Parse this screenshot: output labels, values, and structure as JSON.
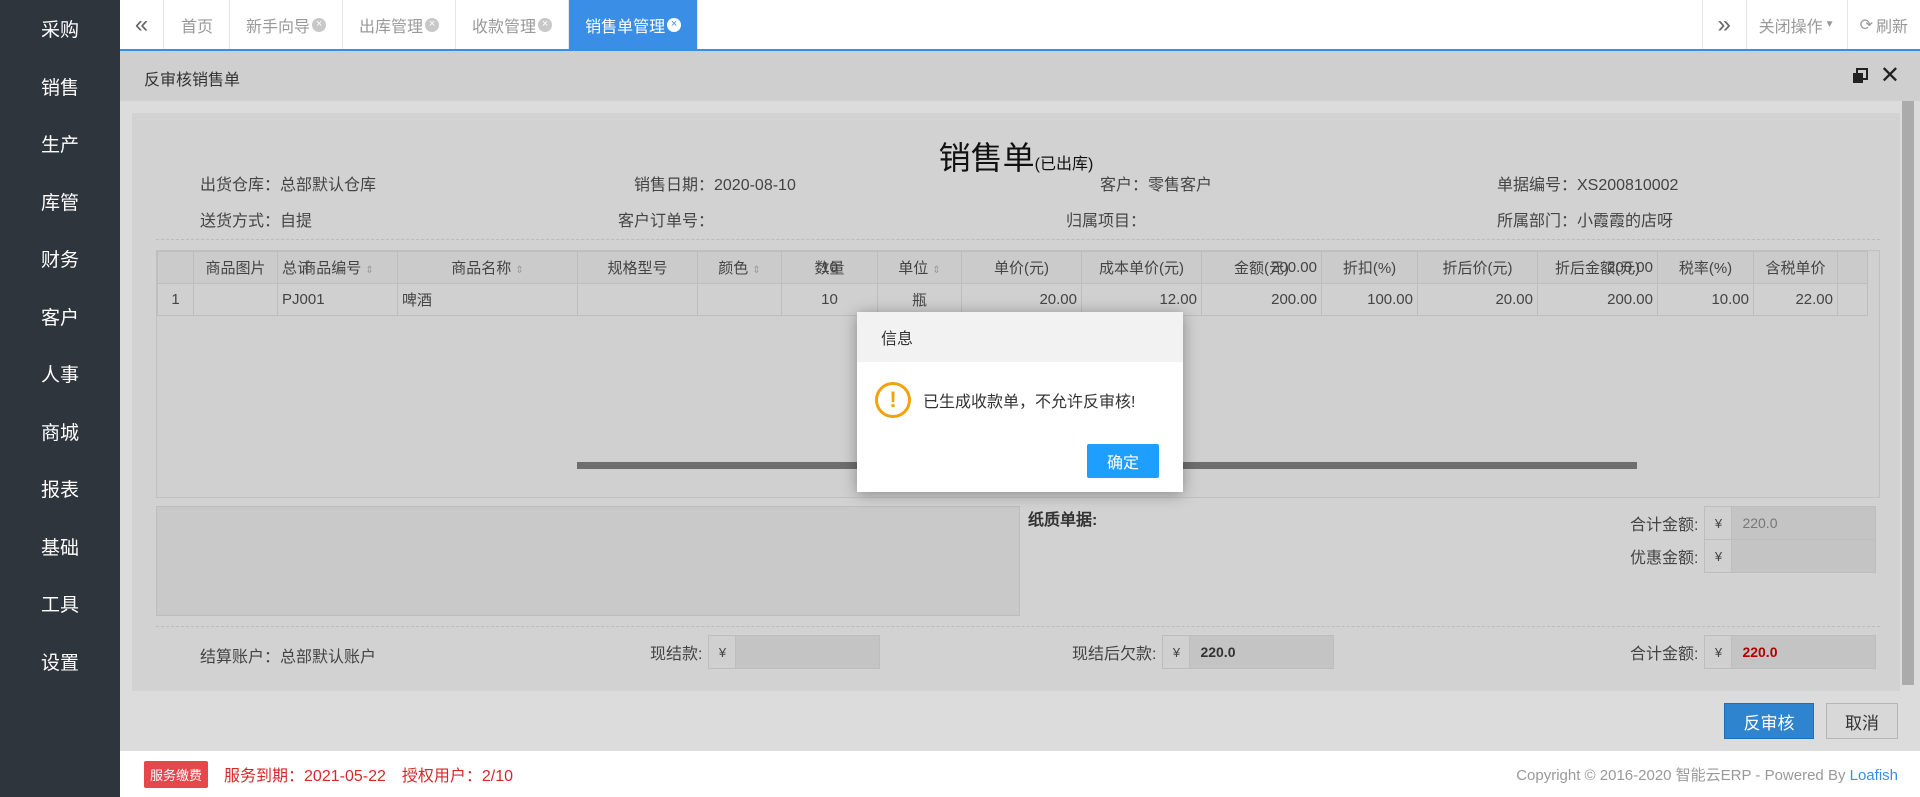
{
  "sidebar": {
    "items": [
      {
        "label": "采购"
      },
      {
        "label": "销售"
      },
      {
        "label": "生产"
      },
      {
        "label": "库管"
      },
      {
        "label": "财务"
      },
      {
        "label": "客户"
      },
      {
        "label": "人事"
      },
      {
        "label": "商城"
      },
      {
        "label": "报表"
      },
      {
        "label": "基础"
      },
      {
        "label": "工具"
      },
      {
        "label": "设置"
      }
    ]
  },
  "tabs": {
    "items": [
      {
        "label": "首页",
        "closable": false
      },
      {
        "label": "新手向导",
        "closable": true
      },
      {
        "label": "出库管理",
        "closable": true
      },
      {
        "label": "收款管理",
        "closable": true
      },
      {
        "label": "销售单管理",
        "closable": true,
        "active": true
      }
    ],
    "close_ops": "关闭操作",
    "refresh": "刷新"
  },
  "window": {
    "title": "反审核销售单"
  },
  "doc": {
    "title": "销售单",
    "status": "(已出库)",
    "fields": {
      "warehouse": "出货仓库：总部默认仓库",
      "sale_date": "销售日期：2020-08-10",
      "customer": "客户：零售客户",
      "bill_no": "单据编号：XS200810002",
      "delivery": "送货方式：自提",
      "cust_order": "客户订单号：",
      "project": "归属项目：",
      "dept": "所属部门：小霞霞的店呀"
    },
    "columns": [
      "商品图片",
      "商品编号",
      "商品名称",
      "规格型号",
      "颜色",
      "数量",
      "单位",
      "单价(元)",
      "成本单价(元)",
      "金额(元)",
      "折扣(%)",
      "折后价(元)",
      "折后金额(元)",
      "税率(%)",
      "含税单价"
    ],
    "rows": [
      {
        "no": "1",
        "image": "",
        "code": "PJ001",
        "name": "啤酒",
        "spec": "",
        "color": "",
        "qty": "10",
        "unit": "瓶",
        "price": "20.00",
        "cost": "12.00",
        "amount": "200.00",
        "discount": "100.00",
        "disc_price": "20.00",
        "disc_amount": "200.00",
        "tax": "10.00",
        "tax_price": "22.00"
      }
    ],
    "total": {
      "label": "总计",
      "qty": "10",
      "amount": "200.00",
      "disc_amount": "200.00"
    },
    "paper_label": "纸质单据:",
    "sum_label": "合计金额:",
    "sum_value": "220.0",
    "discount_label": "优惠金额:",
    "discount_value": "",
    "account": "结算账户：总部默认账户",
    "cash_label": "现结款:",
    "cash_value": "",
    "owe_label": "现结后欠款:",
    "owe_value": "220.0",
    "total_label": "合计金额:",
    "total_value": "220.0",
    "currency": "¥"
  },
  "buttons": {
    "reverse": "反审核",
    "cancel": "取消"
  },
  "footer": {
    "badge": "服务缴费",
    "expire": "服务到期：2021-05-22",
    "users": "授权用户：2/10",
    "copyright": "Copyright © 2016-2020 智能云ERP - Powered By ",
    "brand": "Loafish"
  },
  "modal": {
    "title": "信息",
    "message": "已生成收款单，不允许反审核!",
    "ok": "确定"
  },
  "colors": {
    "accent": "#3a8ee6",
    "sidebar": "#2f353d",
    "warning": "#f0a30a",
    "danger": "#d7272b"
  }
}
